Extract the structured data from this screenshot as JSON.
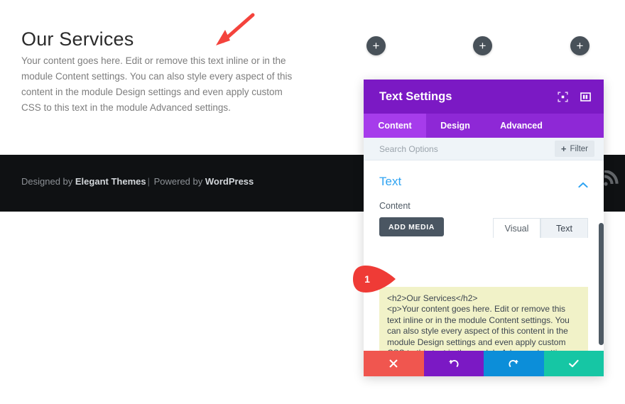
{
  "page": {
    "heading": "Our Services",
    "paragraph": "Your content goes here. Edit or remove this text inline or in the module Content settings. You can also style every aspect of this content in the module Design settings and even apply custom CSS to this text in the module Advanced settings.",
    "footer": {
      "credit_prefix": "Designed by ",
      "credit_brand": "Elegant Themes",
      "credit_sep": "|",
      "credit_mid": " Powered by ",
      "credit_platform": "WordPress",
      "rss_icon": "rss-icon"
    }
  },
  "builder": {
    "add_row_label": "+",
    "add_row_count": 3,
    "arrow_annotation_icon": "red-arrow-down-left-icon",
    "callout_number": "1"
  },
  "modal": {
    "title": "Text Settings",
    "header_icons": [
      {
        "name": "fullscreen-icon"
      },
      {
        "name": "panel-layout-icon"
      }
    ],
    "tabs": [
      {
        "label": "Content",
        "active": true
      },
      {
        "label": "Design",
        "active": false
      },
      {
        "label": "Advanced",
        "active": false
      }
    ],
    "search": {
      "placeholder": "Search Options",
      "value": ""
    },
    "filter_button": {
      "label": "Filter",
      "plus": "+"
    },
    "section": {
      "title": "Text",
      "collapse_icon": "chevron-up-icon",
      "field_label": "Content",
      "add_media_label": "ADD MEDIA",
      "editor_tabs": [
        {
          "label": "Visual",
          "active": false
        },
        {
          "label": "Text",
          "active": true
        }
      ],
      "code_value": "<h2>Our Services</h2>\n<p>Your content goes here. Edit or remove this text inline or in the module Content settings. You can also style every aspect of this content in the module Design settings and even apply custom CSS to this text in the module Advanced settings.</p>"
    },
    "footer_buttons": [
      {
        "name": "cancel-button",
        "icon": "close-icon"
      },
      {
        "name": "undo-button",
        "icon": "undo-icon"
      },
      {
        "name": "redo-button",
        "icon": "redo-icon"
      },
      {
        "name": "save-button",
        "icon": "check-icon"
      }
    ]
  },
  "colors": {
    "modal_header": "#7b19c4",
    "tabbar": "#8e28d6",
    "tab_active": "#a63ceb",
    "section_title": "#2ea3f2",
    "code_bg": "#f1f2c8",
    "cancel": "#f0564f",
    "undo": "#7b19c4",
    "redo": "#0c8ed9",
    "save": "#16c6a4",
    "footer_band": "#0f1113",
    "annotation_red": "#f4433c"
  }
}
